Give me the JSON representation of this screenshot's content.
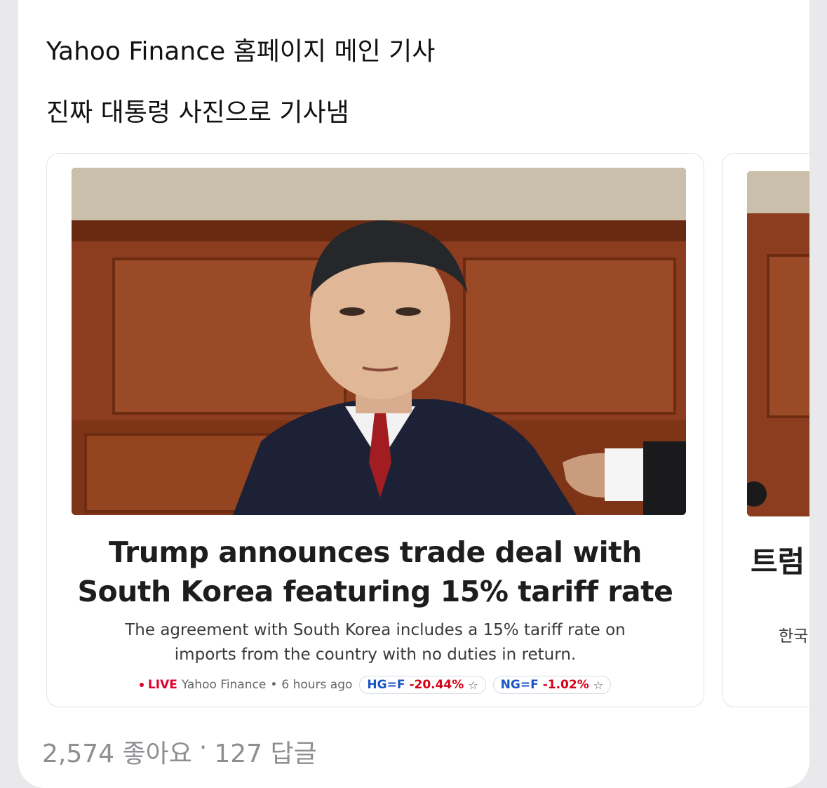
{
  "post": {
    "line1": "Yahoo Finance 홈페이지 메인 기사",
    "line2": "진짜 대통령 사진으로 기사냄"
  },
  "article": {
    "image_name": "news-photo",
    "headline_line1": "Trump announces trade deal with",
    "headline_line2": "South Korea featuring 15% tariff rate",
    "summary_line1": "The agreement with South Korea includes a 15% tariff rate on",
    "summary_line2": "imports from the country with no duties in return.",
    "live_label": "LIVE",
    "source": "Yahoo Finance",
    "separator": "•",
    "time": "6 hours ago",
    "tickers": [
      {
        "symbol": "HG=F",
        "change": "-20.44%",
        "star": "☆"
      },
      {
        "symbol": "NG=F",
        "change": "-1.02%",
        "star": "☆"
      }
    ]
  },
  "next_card": {
    "title_fragment": "트럼",
    "sub_fragment": "한국"
  },
  "stats": {
    "likes": "2,574 좋아요",
    "dot": "·",
    "replies": "127 답글"
  },
  "colors": {
    "live": "#e0002b",
    "ticker_symbol": "#1a55c4",
    "ticker_change": "#d60017"
  }
}
